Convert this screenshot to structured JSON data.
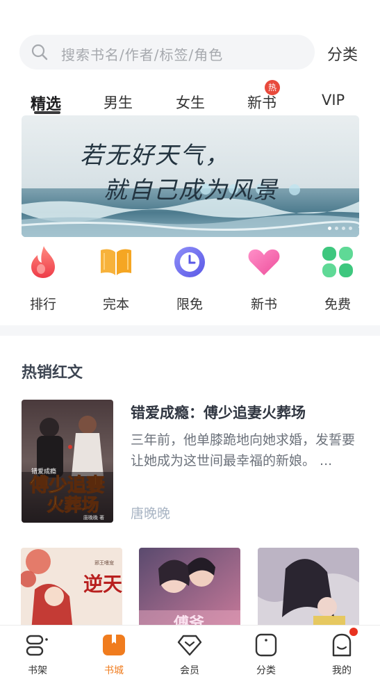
{
  "search": {
    "placeholder": "搜索书名/作者/标签/角色",
    "category_link": "分类"
  },
  "tabs": [
    {
      "label": "精选",
      "active": true
    },
    {
      "label": "男生"
    },
    {
      "label": "女生"
    },
    {
      "label": "新书",
      "badge": "热"
    },
    {
      "label": "VIP"
    }
  ],
  "banner": {
    "line1": "若无好天气，",
    "line2": "就自己成为风景"
  },
  "quick_menu": [
    {
      "label": "排行",
      "icon": "flame-icon",
      "color": "#f2575a"
    },
    {
      "label": "完本",
      "icon": "open-book-icon",
      "color": "#f5a623"
    },
    {
      "label": "限免",
      "icon": "clock-icon",
      "color": "#6f6ff0"
    },
    {
      "label": "新书",
      "icon": "heart-icon",
      "color": "#f261a8"
    },
    {
      "label": "免费",
      "icon": "clover-icon",
      "color": "#4bd08a"
    }
  ],
  "hot_section": {
    "title": "热销红文",
    "featured": {
      "title": "错爱成瘾：傅少追妻火葬场",
      "description": "三年前，他单膝跪地向她求婚，发誓要让她成为这世间最幸福的新娘。 ...",
      "author": "唐晚晚",
      "cover_text": {
        "series": "错爱成瘾",
        "line1": "傅少追妻",
        "line2": "火葬场",
        "author_mark": "唐晚晚 著"
      }
    },
    "grid_covers": [
      {
        "cover_text": "逆天",
        "small_text": "邪王嗜宠"
      },
      {
        "cover_text": "傅爷",
        "small_text": ""
      },
      {
        "cover_text": "",
        "small_text": ""
      }
    ]
  },
  "bottom_nav": [
    {
      "label": "书架",
      "icon": "bookshelf-icon"
    },
    {
      "label": "书城",
      "icon": "bookstore-icon",
      "active": true
    },
    {
      "label": "会员",
      "icon": "diamond-icon"
    },
    {
      "label": "分类",
      "icon": "category-icon"
    },
    {
      "label": "我的",
      "icon": "profile-icon",
      "notification_dot": true
    }
  ],
  "colors": {
    "accent": "#f07c1e",
    "hot_badge": "#e84a3c",
    "author": "#a9b5c4"
  }
}
